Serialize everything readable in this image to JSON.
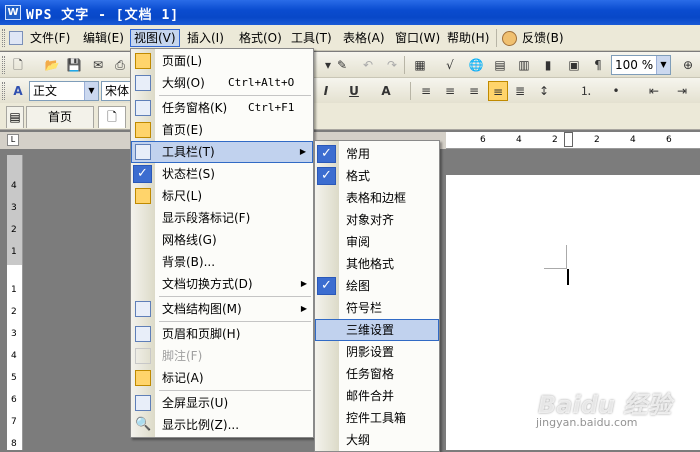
{
  "title": {
    "logo_text": "W",
    "text": "WPS 文字 - [文档 1]"
  },
  "menubar": {
    "items": [
      {
        "label": "文件(F)"
      },
      {
        "label": "编辑(E)"
      },
      {
        "label": "视图(V)"
      },
      {
        "label": "插入(I)"
      },
      {
        "label": "格式(O)"
      },
      {
        "label": "工具(T)"
      },
      {
        "label": "表格(A)"
      },
      {
        "label": "窗口(W)"
      },
      {
        "label": "帮助(H)"
      },
      {
        "label": "反馈(B)"
      }
    ]
  },
  "toolbar2": {
    "style_value": "正文",
    "font_value": "宋体",
    "zoom_value": "100 %"
  },
  "tabs": [
    {
      "label": "首页"
    }
  ],
  "rulers": {
    "h_ticks": [
      "6",
      "4",
      "2",
      "2",
      "4",
      "6"
    ],
    "v_ticks": [
      "4",
      "3",
      "2",
      "1",
      "1",
      "2",
      "3",
      "4",
      "5",
      "6",
      "7",
      "8"
    ]
  },
  "view_menu": {
    "items": [
      {
        "label": "页面(L)",
        "shortcut": ""
      },
      {
        "label": "大纲(O)",
        "shortcut": "Ctrl+Alt+O"
      },
      {
        "label": "任务窗格(K)",
        "shortcut": "Ctrl+F1"
      },
      {
        "label": "首页(E)",
        "shortcut": ""
      },
      {
        "label": "工具栏(T)",
        "shortcut": ""
      },
      {
        "label": "状态栏(S)",
        "shortcut": ""
      },
      {
        "label": "标尺(L)",
        "shortcut": ""
      },
      {
        "label": "显示段落标记(F)",
        "shortcut": ""
      },
      {
        "label": "网格线(G)",
        "shortcut": ""
      },
      {
        "label": "背景(B)...",
        "shortcut": ""
      },
      {
        "label": "文档切换方式(D)",
        "shortcut": ""
      },
      {
        "label": "文档结构图(M)",
        "shortcut": ""
      },
      {
        "label": "页眉和页脚(H)",
        "shortcut": ""
      },
      {
        "label": "脚注(F)",
        "shortcut": ""
      },
      {
        "label": "标记(A)",
        "shortcut": ""
      },
      {
        "label": "全屏显示(U)",
        "shortcut": ""
      },
      {
        "label": "显示比例(Z)...",
        "shortcut": ""
      }
    ]
  },
  "toolbar_submenu": {
    "items": [
      {
        "label": "常用",
        "checked": true
      },
      {
        "label": "格式",
        "checked": true
      },
      {
        "label": "表格和边框",
        "checked": false
      },
      {
        "label": "对象对齐",
        "checked": false
      },
      {
        "label": "审阅",
        "checked": false
      },
      {
        "label": "其他格式",
        "checked": false
      },
      {
        "label": "绘图",
        "checked": true
      },
      {
        "label": "符号栏",
        "checked": false
      },
      {
        "label": "三维设置",
        "checked": false
      },
      {
        "label": "阴影设置",
        "checked": false
      },
      {
        "label": "任务窗格",
        "checked": false
      },
      {
        "label": "邮件合并",
        "checked": false
      },
      {
        "label": "控件工具箱",
        "checked": false
      },
      {
        "label": "大纲",
        "checked": false
      }
    ]
  },
  "watermark": {
    "text": "Baidu 经验",
    "sub": "jingyan.baidu.com"
  },
  "colors": {
    "titlebar": "#0a4cd0",
    "menu_highlight": "#c1d2ee",
    "check_bg": "#3c6dd0"
  }
}
